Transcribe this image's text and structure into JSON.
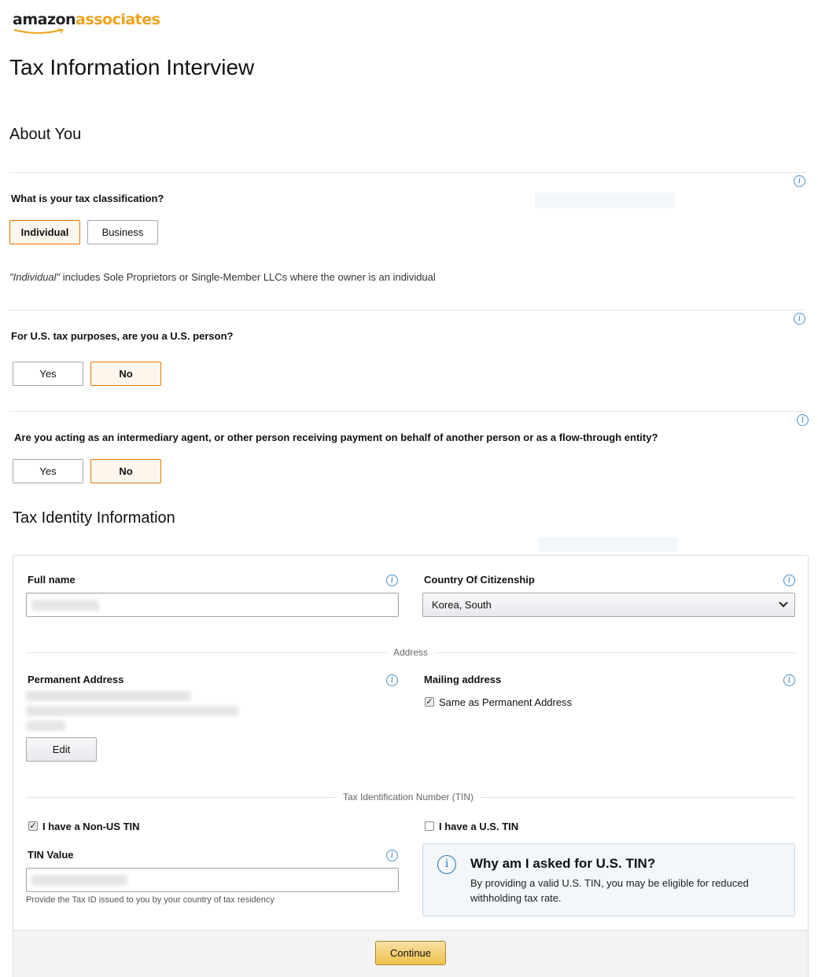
{
  "brand": {
    "part1": "amazon",
    "part2": "associates"
  },
  "page_title": "Tax Information Interview",
  "about": {
    "heading": "About You",
    "classification": {
      "question": "What is your tax classification?",
      "options": [
        "Individual",
        "Business"
      ],
      "selected": "Individual",
      "note_em": "\"Individual\"",
      "note_rest": " includes Sole Proprietors or Single-Member LLCs where the owner is an individual"
    },
    "us_person": {
      "question": "For U.S. tax purposes, are you a U.S. person?",
      "yes": "Yes",
      "no": "No",
      "selected": "No"
    },
    "intermediary": {
      "question": "Are you acting as an intermediary agent, or other person receiving payment on behalf of another person or as a flow-through entity?",
      "yes": "Yes",
      "no": "No",
      "selected": "No"
    }
  },
  "identity": {
    "heading": "Tax Identity Information",
    "full_name_label": "Full name",
    "citizenship_label": "Country Of Citizenship",
    "citizenship_value": "Korea, South",
    "address_divider": "Address",
    "permanent_address_label": "Permanent Address",
    "mailing_address_label": "Mailing address",
    "same_as_permanent": "Same as Permanent Address",
    "same_as_permanent_checked": true,
    "edit_button": "Edit",
    "tin_divider": "Tax Identification Number (TIN)",
    "non_us_tin": "I have a Non-US TIN",
    "non_us_tin_checked": true,
    "us_tin": "I have a U.S. TIN",
    "us_tin_checked": false,
    "tin_value_label": "TIN Value",
    "tin_hint": "Provide the Tax ID issued to you by your country of tax residency",
    "why_title": "Why am I asked for U.S. TIN?",
    "why_body": "By providing a valid U.S. TIN, you may be eligible for reduced withholding tax rate."
  },
  "continue_button": "Continue",
  "colors": {
    "selected_border": "#e77600",
    "brand_orange": "#f0a31b",
    "continue_bg": "#f0c14b",
    "info_blue": "#2b72b3"
  }
}
